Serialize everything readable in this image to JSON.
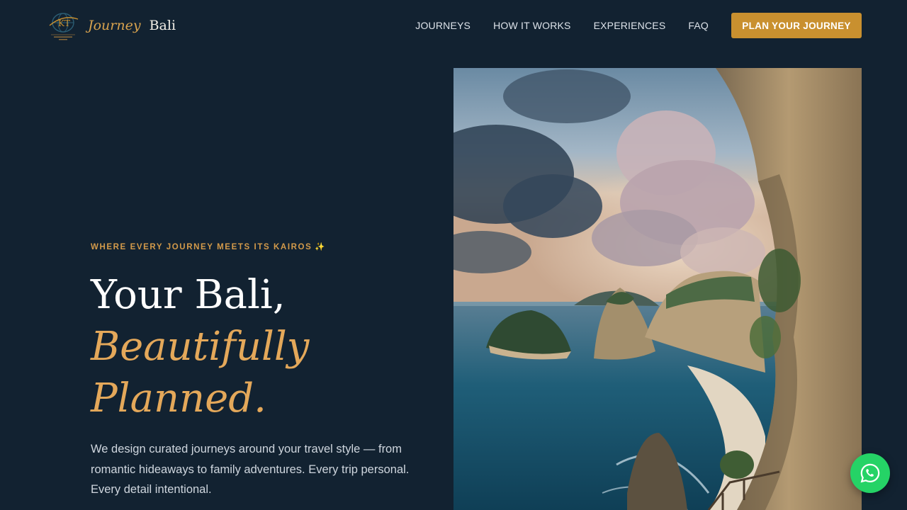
{
  "brand": {
    "word1": "Journey",
    "word2": "Bali",
    "emblem_icon": "kairos-globe-logo-icon",
    "accent_color": "#c9902f"
  },
  "nav": {
    "items": [
      {
        "label": "JOURNEYS"
      },
      {
        "label": "HOW IT WORKS"
      },
      {
        "label": "EXPERIENCES"
      },
      {
        "label": "FAQ"
      }
    ],
    "cta_label": "PLAN YOUR JOURNEY"
  },
  "hero": {
    "eyebrow": "WHERE EVERY JOURNEY MEETS ITS KAIROS",
    "eyebrow_icon": "sparkles-icon",
    "title_line1": "Your Bali,",
    "title_line2": "Beautifully",
    "title_line3": "Planned.",
    "description": "We design curated journeys around your travel style — from romantic hideaways to family adventures. Every trip personal. Every detail intentional.",
    "image": "bali-coastal-cliffs-photo"
  },
  "chat": {
    "icon": "whatsapp-icon",
    "color": "#25d366"
  },
  "colors": {
    "background": "#122231",
    "gold": "#e4a85a",
    "text_light": "#ffffff"
  }
}
